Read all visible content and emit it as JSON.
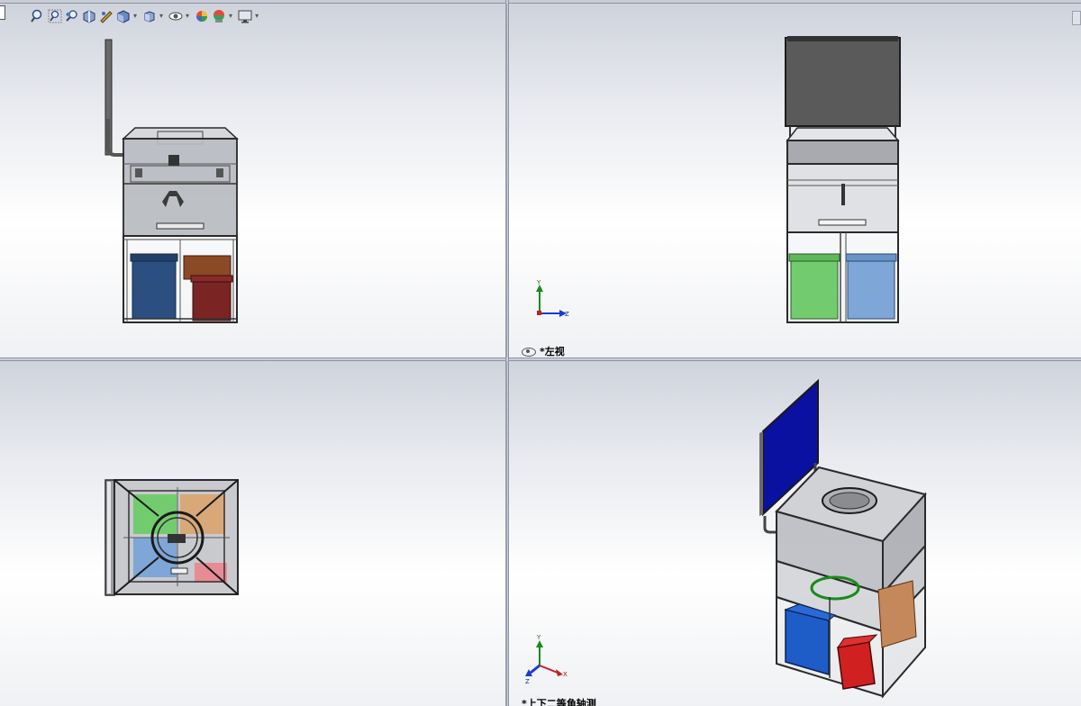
{
  "viewports": {
    "top_left": {
      "label": ""
    },
    "top_right": {
      "label": "*左视"
    },
    "bottom_left": {
      "label": ""
    },
    "bottom_right": {
      "label": "*上下二等角轴测"
    }
  },
  "toolbar": {
    "items": [
      {
        "icon": "zoom-to-fit-icon"
      },
      {
        "icon": "zoom-to-area-icon"
      },
      {
        "icon": "previous-view-icon"
      },
      {
        "icon": "section-view-icon"
      },
      {
        "icon": "dynamic-annotation-icon"
      },
      {
        "icon": "view-orientation-icon"
      },
      {
        "icon": "display-style-icon"
      },
      {
        "icon": "hide-show-items-icon"
      },
      {
        "icon": "edit-appearance-icon"
      },
      {
        "icon": "apply-scene-icon"
      },
      {
        "icon": "view-settings-icon"
      }
    ]
  },
  "triads": {
    "top_right": {
      "y": "Y",
      "z": "Z"
    },
    "bottom_right": {
      "y": "Y",
      "z": "Z",
      "x": "X"
    }
  },
  "colors": {
    "bin_blue": "#2a4f80",
    "bin_brown": "#8a4a26",
    "bin_red": "#8a2a2a",
    "bin_green": "#72cc6e",
    "bin_light_blue": "#7ea6d6",
    "bin_orange": "#d8a878",
    "bin_pink": "#e88c94",
    "screen_grey": "#5a5a5a",
    "screen_blue": "#0a10a0",
    "frame": "#3a3a3a",
    "glass": "#b8bcc4"
  }
}
